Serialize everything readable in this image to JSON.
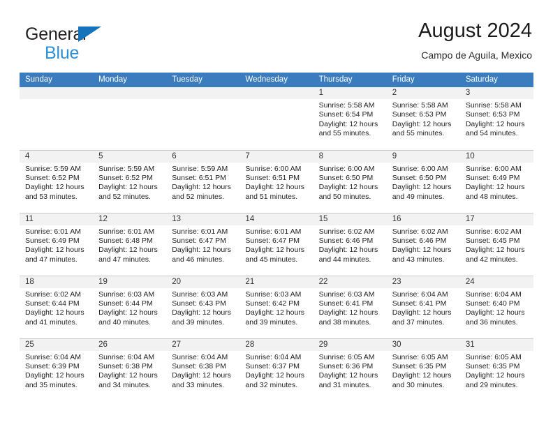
{
  "brand": {
    "word1": "General",
    "word2": "Blue",
    "triangle_color": "#1573bb",
    "blue_color": "#2e8fd6"
  },
  "header": {
    "title": "August 2024",
    "subtitle": "Campo de Aguila, Mexico"
  },
  "calendar": {
    "header_bg": "#3a7cbe",
    "daynum_bg": "#f2f2f2",
    "weekdays": [
      "Sunday",
      "Monday",
      "Tuesday",
      "Wednesday",
      "Thursday",
      "Friday",
      "Saturday"
    ],
    "weeks": [
      [
        {
          "day": "",
          "empty": true
        },
        {
          "day": "",
          "empty": true
        },
        {
          "day": "",
          "empty": true
        },
        {
          "day": "",
          "empty": true
        },
        {
          "day": "1",
          "sunrise": "Sunrise: 5:58 AM",
          "sunset": "Sunset: 6:54 PM",
          "daylight": "Daylight: 12 hours and 55 minutes."
        },
        {
          "day": "2",
          "sunrise": "Sunrise: 5:58 AM",
          "sunset": "Sunset: 6:53 PM",
          "daylight": "Daylight: 12 hours and 55 minutes."
        },
        {
          "day": "3",
          "sunrise": "Sunrise: 5:58 AM",
          "sunset": "Sunset: 6:53 PM",
          "daylight": "Daylight: 12 hours and 54 minutes."
        }
      ],
      [
        {
          "day": "4",
          "sunrise": "Sunrise: 5:59 AM",
          "sunset": "Sunset: 6:52 PM",
          "daylight": "Daylight: 12 hours and 53 minutes."
        },
        {
          "day": "5",
          "sunrise": "Sunrise: 5:59 AM",
          "sunset": "Sunset: 6:52 PM",
          "daylight": "Daylight: 12 hours and 52 minutes."
        },
        {
          "day": "6",
          "sunrise": "Sunrise: 5:59 AM",
          "sunset": "Sunset: 6:51 PM",
          "daylight": "Daylight: 12 hours and 52 minutes."
        },
        {
          "day": "7",
          "sunrise": "Sunrise: 6:00 AM",
          "sunset": "Sunset: 6:51 PM",
          "daylight": "Daylight: 12 hours and 51 minutes."
        },
        {
          "day": "8",
          "sunrise": "Sunrise: 6:00 AM",
          "sunset": "Sunset: 6:50 PM",
          "daylight": "Daylight: 12 hours and 50 minutes."
        },
        {
          "day": "9",
          "sunrise": "Sunrise: 6:00 AM",
          "sunset": "Sunset: 6:50 PM",
          "daylight": "Daylight: 12 hours and 49 minutes."
        },
        {
          "day": "10",
          "sunrise": "Sunrise: 6:00 AM",
          "sunset": "Sunset: 6:49 PM",
          "daylight": "Daylight: 12 hours and 48 minutes."
        }
      ],
      [
        {
          "day": "11",
          "sunrise": "Sunrise: 6:01 AM",
          "sunset": "Sunset: 6:49 PM",
          "daylight": "Daylight: 12 hours and 47 minutes."
        },
        {
          "day": "12",
          "sunrise": "Sunrise: 6:01 AM",
          "sunset": "Sunset: 6:48 PM",
          "daylight": "Daylight: 12 hours and 47 minutes."
        },
        {
          "day": "13",
          "sunrise": "Sunrise: 6:01 AM",
          "sunset": "Sunset: 6:47 PM",
          "daylight": "Daylight: 12 hours and 46 minutes."
        },
        {
          "day": "14",
          "sunrise": "Sunrise: 6:01 AM",
          "sunset": "Sunset: 6:47 PM",
          "daylight": "Daylight: 12 hours and 45 minutes."
        },
        {
          "day": "15",
          "sunrise": "Sunrise: 6:02 AM",
          "sunset": "Sunset: 6:46 PM",
          "daylight": "Daylight: 12 hours and 44 minutes."
        },
        {
          "day": "16",
          "sunrise": "Sunrise: 6:02 AM",
          "sunset": "Sunset: 6:46 PM",
          "daylight": "Daylight: 12 hours and 43 minutes."
        },
        {
          "day": "17",
          "sunrise": "Sunrise: 6:02 AM",
          "sunset": "Sunset: 6:45 PM",
          "daylight": "Daylight: 12 hours and 42 minutes."
        }
      ],
      [
        {
          "day": "18",
          "sunrise": "Sunrise: 6:02 AM",
          "sunset": "Sunset: 6:44 PM",
          "daylight": "Daylight: 12 hours and 41 minutes."
        },
        {
          "day": "19",
          "sunrise": "Sunrise: 6:03 AM",
          "sunset": "Sunset: 6:44 PM",
          "daylight": "Daylight: 12 hours and 40 minutes."
        },
        {
          "day": "20",
          "sunrise": "Sunrise: 6:03 AM",
          "sunset": "Sunset: 6:43 PM",
          "daylight": "Daylight: 12 hours and 39 minutes."
        },
        {
          "day": "21",
          "sunrise": "Sunrise: 6:03 AM",
          "sunset": "Sunset: 6:42 PM",
          "daylight": "Daylight: 12 hours and 39 minutes."
        },
        {
          "day": "22",
          "sunrise": "Sunrise: 6:03 AM",
          "sunset": "Sunset: 6:41 PM",
          "daylight": "Daylight: 12 hours and 38 minutes."
        },
        {
          "day": "23",
          "sunrise": "Sunrise: 6:04 AM",
          "sunset": "Sunset: 6:41 PM",
          "daylight": "Daylight: 12 hours and 37 minutes."
        },
        {
          "day": "24",
          "sunrise": "Sunrise: 6:04 AM",
          "sunset": "Sunset: 6:40 PM",
          "daylight": "Daylight: 12 hours and 36 minutes."
        }
      ],
      [
        {
          "day": "25",
          "sunrise": "Sunrise: 6:04 AM",
          "sunset": "Sunset: 6:39 PM",
          "daylight": "Daylight: 12 hours and 35 minutes."
        },
        {
          "day": "26",
          "sunrise": "Sunrise: 6:04 AM",
          "sunset": "Sunset: 6:38 PM",
          "daylight": "Daylight: 12 hours and 34 minutes."
        },
        {
          "day": "27",
          "sunrise": "Sunrise: 6:04 AM",
          "sunset": "Sunset: 6:38 PM",
          "daylight": "Daylight: 12 hours and 33 minutes."
        },
        {
          "day": "28",
          "sunrise": "Sunrise: 6:04 AM",
          "sunset": "Sunset: 6:37 PM",
          "daylight": "Daylight: 12 hours and 32 minutes."
        },
        {
          "day": "29",
          "sunrise": "Sunrise: 6:05 AM",
          "sunset": "Sunset: 6:36 PM",
          "daylight": "Daylight: 12 hours and 31 minutes."
        },
        {
          "day": "30",
          "sunrise": "Sunrise: 6:05 AM",
          "sunset": "Sunset: 6:35 PM",
          "daylight": "Daylight: 12 hours and 30 minutes."
        },
        {
          "day": "31",
          "sunrise": "Sunrise: 6:05 AM",
          "sunset": "Sunset: 6:35 PM",
          "daylight": "Daylight: 12 hours and 29 minutes."
        }
      ]
    ]
  }
}
